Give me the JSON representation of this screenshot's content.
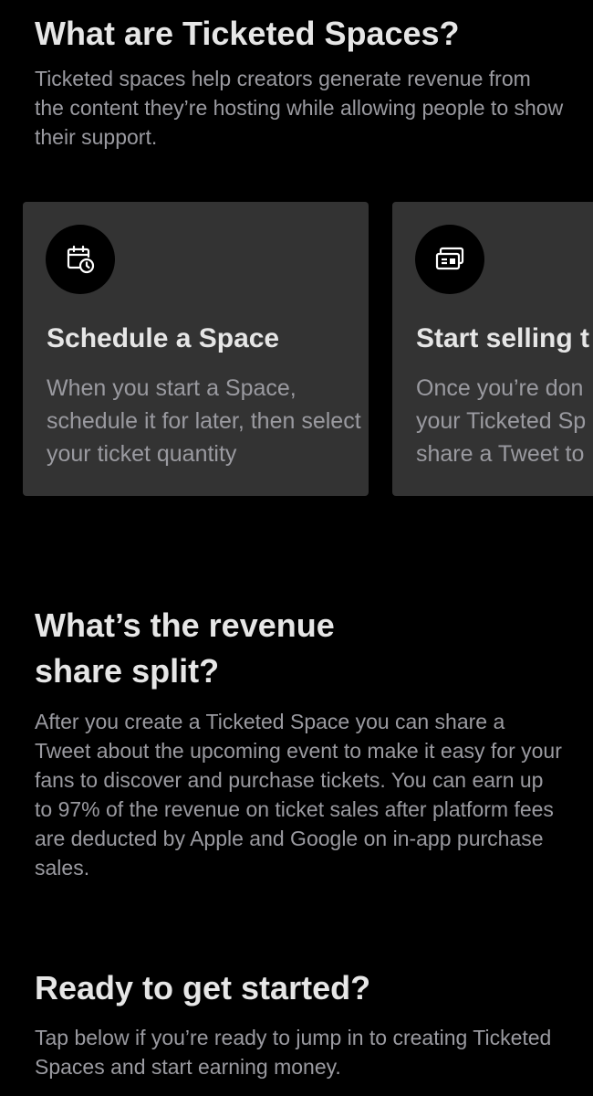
{
  "intro": {
    "heading": "What are Ticketed Spaces?",
    "text": "Ticketed spaces help creators generate revenue from the content they’re hosting while allowing people to show their support."
  },
  "cards": [
    {
      "icon": "calendar-clock-icon",
      "title": "Schedule a Space",
      "text": "When you start a Space, schedule it for later, then select your ticket quantity"
    },
    {
      "icon": "ticket-icon",
      "title": "Start selling t",
      "text_lines": [
        "Once you’re don",
        "your Ticketed Sp",
        "share a Tweet to"
      ]
    }
  ],
  "revenue": {
    "heading": "What’s the revenue share split?",
    "text": "After you create a Ticketed Space you can share a Tweet about the upcoming event to make it easy for your fans to discover and purchase tickets. You can earn up to 97% of the revenue on ticket sales after platform fees are deducted by Apple and Google on in-app purchase sales."
  },
  "get_started": {
    "heading": "Ready to get started?",
    "text": "Tap below if you’re ready to jump in to creating Ticketed Spaces and start earning money."
  },
  "colors": {
    "background": "#000000",
    "card": "#333333",
    "heading": "#e6e6e6",
    "body_text": "#9a9aa0"
  }
}
